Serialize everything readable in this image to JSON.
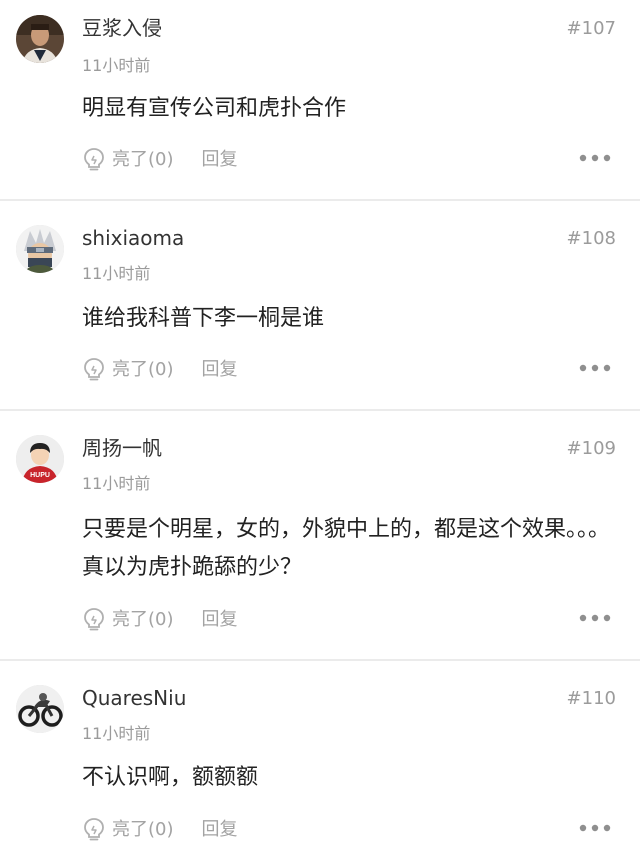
{
  "comments": [
    {
      "username": "豆浆入侵",
      "floor": "#107",
      "time": "11小时前",
      "content": "明显有宣传公司和虎扑合作",
      "light_label": "亮了(0)",
      "reply_label": "回复",
      "avatar_icon": "avatar-man-photo-icon"
    },
    {
      "username": "shixiaoma",
      "floor": "#108",
      "time": "11小时前",
      "content": "谁给我科普下李一桐是谁",
      "light_label": "亮了(0)",
      "reply_label": "回复",
      "avatar_icon": "avatar-anime-ninja-icon"
    },
    {
      "username": "周扬一帆",
      "floor": "#109",
      "time": "11小时前",
      "content": "只要是个明星，女的，外貌中上的，都是这个效果。。。真以为虎扑跪舔的少？",
      "light_label": "亮了(0)",
      "reply_label": "回复",
      "avatar_icon": "avatar-hupu-default-icon",
      "avatar_text": "HUPU"
    },
    {
      "username": "QuaresNiu",
      "floor": "#110",
      "time": "11小时前",
      "content": "不认识啊，额额额",
      "light_label": "亮了(0)",
      "reply_label": "回复",
      "avatar_icon": "avatar-motorcycle-icon"
    }
  ],
  "colors": {
    "meta_gray": "#9b9b9b",
    "text_dark": "#222222",
    "divider": "#ebebeb"
  }
}
